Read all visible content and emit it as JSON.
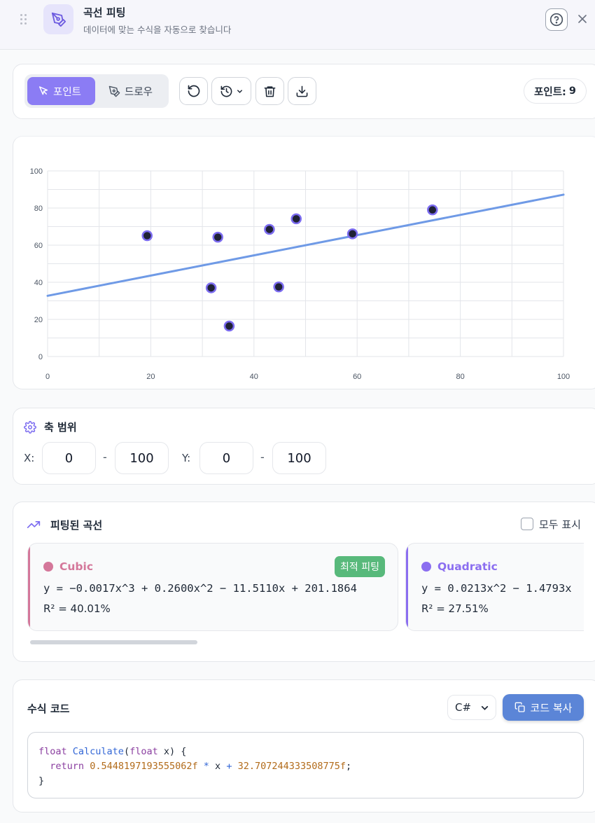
{
  "header": {
    "title": "곡선 피팅",
    "subtitle": "데이터에 맞는 수식을 자동으로 찾습니다"
  },
  "toolbar": {
    "modes": [
      {
        "label": "포인트",
        "active": true
      },
      {
        "label": "드로우",
        "active": false
      }
    ],
    "tools": [
      "undo-icon",
      "history-icon",
      "trash-icon",
      "download-icon"
    ],
    "point_count_label": "포인트:",
    "point_count": "9"
  },
  "chart_data": {
    "type": "scatter",
    "xlim": [
      0,
      100
    ],
    "ylim": [
      0,
      100
    ],
    "x_ticks": [
      "0",
      "20",
      "40",
      "60",
      "80",
      "100"
    ],
    "y_ticks": [
      "0",
      "20",
      "40",
      "60",
      "80",
      "100"
    ],
    "grid": true,
    "points": [
      {
        "x": 19.3,
        "y": 65.1
      },
      {
        "x": 31.7,
        "y": 37.0
      },
      {
        "x": 33.0,
        "y": 64.3
      },
      {
        "x": 35.2,
        "y": 16.4
      },
      {
        "x": 43.0,
        "y": 68.5
      },
      {
        "x": 44.8,
        "y": 37.5
      },
      {
        "x": 48.2,
        "y": 74.2
      },
      {
        "x": 59.1,
        "y": 66.1
      },
      {
        "x": 74.6,
        "y": 79.0
      }
    ],
    "fit_line": {
      "slope": 0.5448197193555062,
      "intercept": 32.707244333508775
    },
    "colors": {
      "line": "#6f9ae6",
      "point_fill": "#1f2235",
      "point_stroke": "#7c6cf0"
    }
  },
  "axis_range": {
    "title": "축 범위",
    "x_label": "X:",
    "x_min": "0",
    "x_max": "100",
    "y_label": "Y:",
    "y_min": "0",
    "y_max": "100",
    "separator": "-"
  },
  "fitted": {
    "title": "피팅된 곡선",
    "show_all_label": "모두 표시",
    "show_all_checked": false,
    "curves": [
      {
        "name": "Cubic",
        "color": "#d4779a",
        "equation": "y = −0.0017x^3 + 0.2600x^2 − 11.5110x + 201.1864",
        "r2": "R² = 40.01%",
        "badge": "최적 피팅"
      },
      {
        "name": "Quadratic",
        "color": "#8b6ef0",
        "equation": "y = 0.0213x^2 − 1.4793x",
        "r2": "R² = 27.51%",
        "badge": ""
      }
    ]
  },
  "code": {
    "title": "수식 코드",
    "language": "C#",
    "copy_label": "코드 복사",
    "line1_kw": "float",
    "line1_fn": "Calculate",
    "line1_open": "(",
    "line1_kw2": "float",
    "line1_rest": " x) {",
    "line2_kw": "return",
    "line2_num1": "0.5448197193555062f",
    "line2_op1": "*",
    "line2_var": "x",
    "line2_op2": "+",
    "line2_num2": "32.707244333508775f",
    "line2_end": ";",
    "line3": "}"
  }
}
